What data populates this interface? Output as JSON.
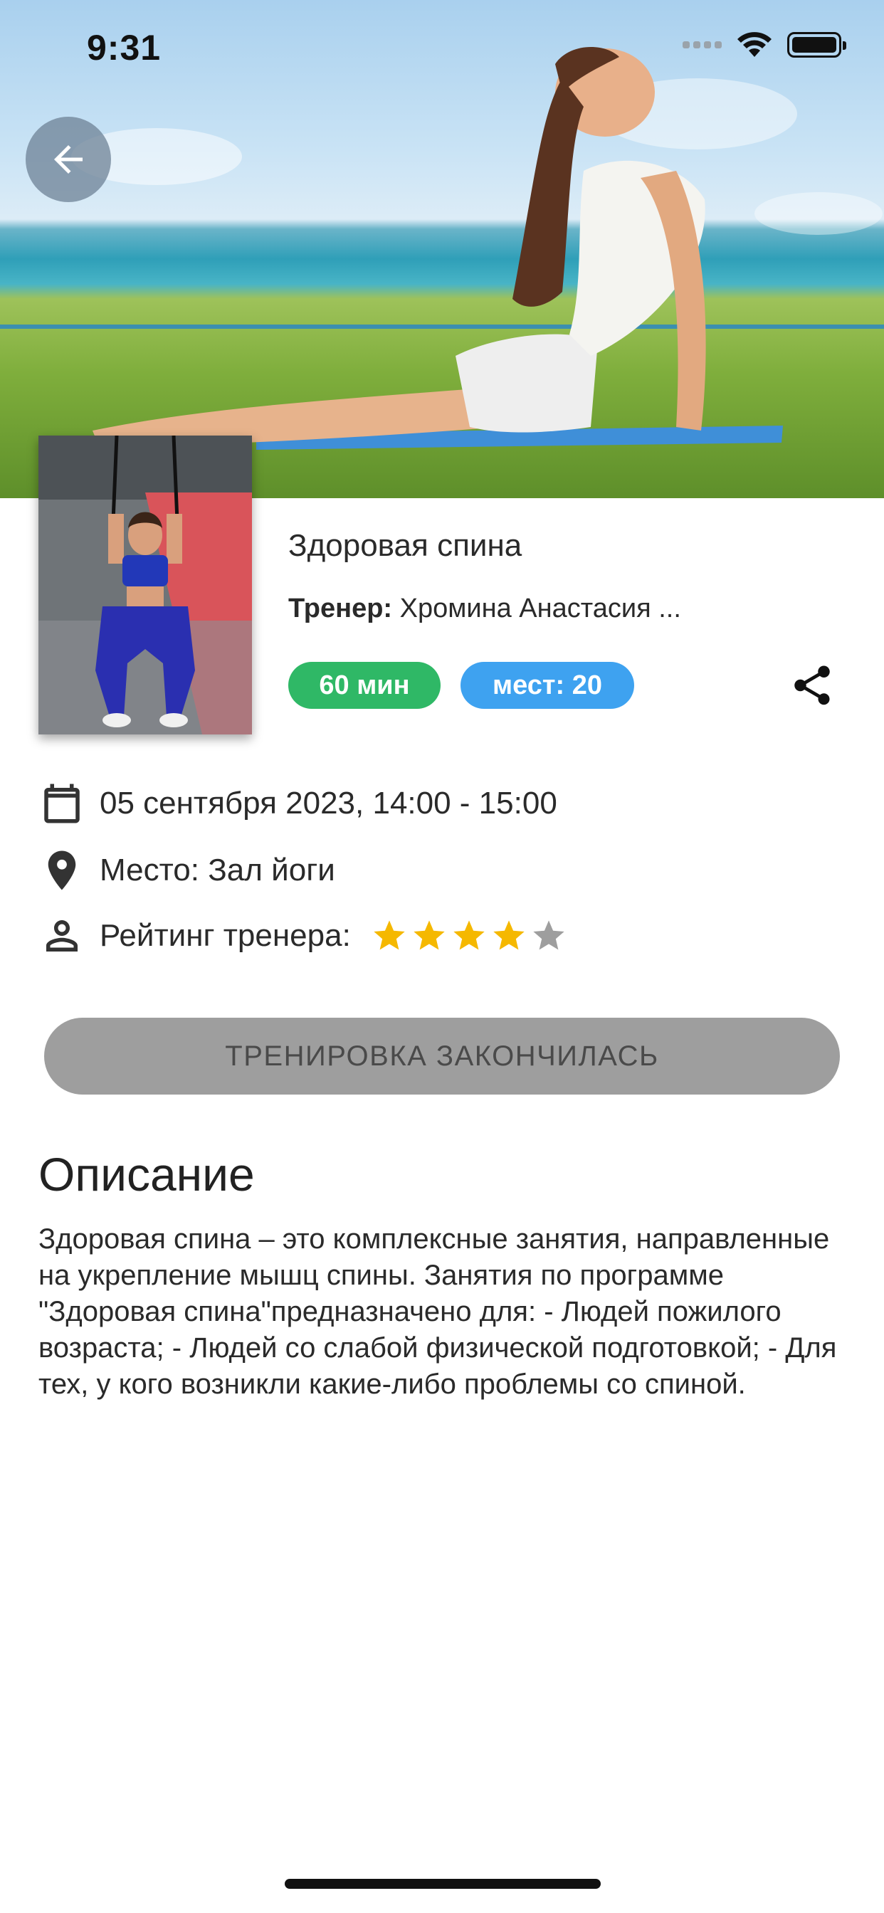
{
  "status_bar": {
    "time": "9:31"
  },
  "hero": {
    "image": "woman-yoga-cobra-pose-beach-photo"
  },
  "thumbnail": {
    "image": "trainer-trx-photo"
  },
  "class": {
    "title": "Здоровая спина",
    "trainer_label": "Тренер:",
    "trainer_name": "Хромина Анастасия ...",
    "duration_badge": "60 мин",
    "seats_badge": "мест: 20"
  },
  "info": {
    "datetime": "05 сентября 2023, 14:00 - 15:00",
    "place": "Место:  Зал йоги",
    "rating_label": "Рейтинг тренера:",
    "rating_value": 4,
    "rating_max": 5
  },
  "button": {
    "label": "ТРЕНИРОВКА ЗАКОНЧИЛАСЬ"
  },
  "description": {
    "heading": "Описание",
    "text": "Здоровая спина – это комплексные занятия, направленные на укрепление мышц спины. Занятия по программе \"Здоровая спина\"предназначено для: - Людей пожилого возраста; - Людей со слабой физической подготовкой; - Для тех, у кого возникли какие-либо проблемы со спиной."
  },
  "colors": {
    "duration_badge": "#2fb866",
    "seats_badge": "#3ea2f0",
    "star_filled": "#f5b800",
    "star_empty": "#9e9e9e",
    "disabled_button": "#9e9e9e"
  },
  "icons": [
    "arrow-left-icon",
    "share-icon",
    "calendar-icon",
    "location-pin-icon",
    "person-icon",
    "star-icon",
    "wifi-icon",
    "battery-icon",
    "signal-icon"
  ]
}
